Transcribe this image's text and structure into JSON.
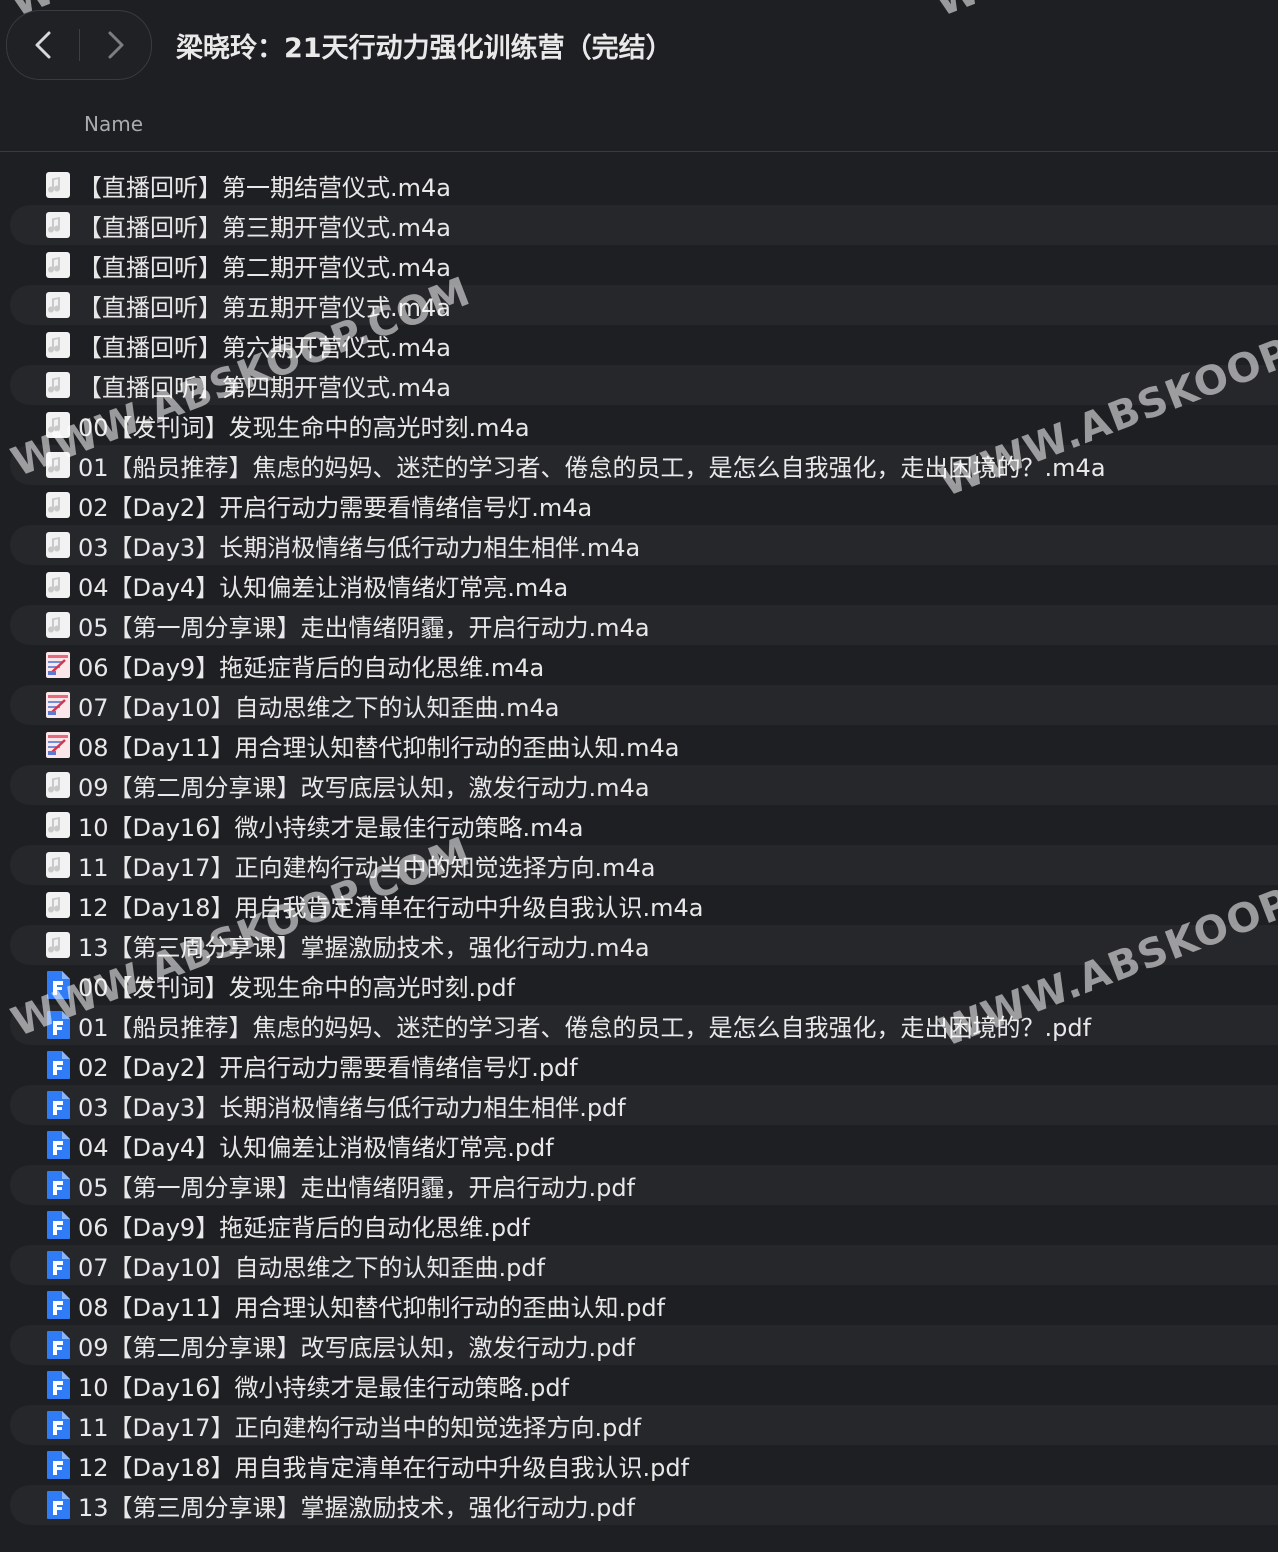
{
  "window": {
    "title": "梁晓玲：21天行动力强化训练营（完结）"
  },
  "toolbar": {
    "back_icon": "chevron-left-icon",
    "forward_icon": "chevron-right-icon"
  },
  "columns": {
    "name": "Name"
  },
  "files": [
    {
      "name": "【直播回听】第一期结营仪式.m4a",
      "icon": "audio"
    },
    {
      "name": "【直播回听】第三期开营仪式.m4a",
      "icon": "audio"
    },
    {
      "name": "【直播回听】第二期开营仪式.m4a",
      "icon": "audio"
    },
    {
      "name": "【直播回听】第五期开营仪式.m4a",
      "icon": "audio"
    },
    {
      "name": "【直播回听】第六期开营仪式.m4a",
      "icon": "audio"
    },
    {
      "name": "【直播回听】第四期开营仪式.m4a",
      "icon": "audio"
    },
    {
      "name": "00【发刊词】发现生命中的高光时刻.m4a",
      "icon": "audio"
    },
    {
      "name": "01【船员推荐】焦虑的妈妈、迷茫的学习者、倦怠的员工，是怎么自我强化，走出困境的？.m4a",
      "icon": "audio"
    },
    {
      "name": "02【Day2】开启行动力需要看情绪信号灯.m4a",
      "icon": "audio"
    },
    {
      "name": "03【Day3】长期消极情绪与低行动力相生相伴.m4a",
      "icon": "audio"
    },
    {
      "name": "04【Day4】认知偏差让消极情绪灯常亮.m4a",
      "icon": "audio"
    },
    {
      "name": "05【第一周分享课】走出情绪阴霾，开启行动力.m4a",
      "icon": "audio"
    },
    {
      "name": "06【Day9】拖延症背后的自动化思维.m4a",
      "icon": "thumb"
    },
    {
      "name": "07【Day10】自动思维之下的认知歪曲.m4a",
      "icon": "thumb"
    },
    {
      "name": "08【Day11】用合理认知替代抑制行动的歪曲认知.m4a",
      "icon": "thumb"
    },
    {
      "name": "09【第二周分享课】改写底层认知，激发行动力.m4a",
      "icon": "audio"
    },
    {
      "name": "10【Day16】微小持续才是最佳行动策略.m4a",
      "icon": "audio"
    },
    {
      "name": "11【Day17】正向建构行动当中的知觉选择方向.m4a",
      "icon": "audio"
    },
    {
      "name": "12【Day18】用自我肯定清单在行动中升级自我认识.m4a",
      "icon": "audio"
    },
    {
      "name": "13【第三周分享课】掌握激励技术，强化行动力.m4a",
      "icon": "audio"
    },
    {
      "name": "00【发刊词】发现生命中的高光时刻.pdf",
      "icon": "pdf"
    },
    {
      "name": "01【船员推荐】焦虑的妈妈、迷茫的学习者、倦怠的员工，是怎么自我强化，走出困境的？.pdf",
      "icon": "pdf"
    },
    {
      "name": "02【Day2】开启行动力需要看情绪信号灯.pdf",
      "icon": "pdf"
    },
    {
      "name": "03【Day3】长期消极情绪与低行动力相生相伴.pdf",
      "icon": "pdf"
    },
    {
      "name": "04【Day4】认知偏差让消极情绪灯常亮.pdf",
      "icon": "pdf"
    },
    {
      "name": "05【第一周分享课】走出情绪阴霾，开启行动力.pdf",
      "icon": "pdf"
    },
    {
      "name": "06【Day9】拖延症背后的自动化思维.pdf",
      "icon": "pdf"
    },
    {
      "name": "07【Day10】自动思维之下的认知歪曲.pdf",
      "icon": "pdf"
    },
    {
      "name": "08【Day11】用合理认知替代抑制行动的歪曲认知.pdf",
      "icon": "pdf"
    },
    {
      "name": "09【第二周分享课】改写底层认知，激发行动力.pdf",
      "icon": "pdf"
    },
    {
      "name": "10【Day16】微小持续才是最佳行动策略.pdf",
      "icon": "pdf"
    },
    {
      "name": "11【Day17】正向建构行动当中的知觉选择方向.pdf",
      "icon": "pdf"
    },
    {
      "name": "12【Day18】用自我肯定清单在行动中升级自我认识.pdf",
      "icon": "pdf"
    },
    {
      "name": "13【第三周分享课】掌握激励技术，强化行动力.pdf",
      "icon": "pdf"
    }
  ],
  "watermark": {
    "text": "WWW.ABSKOOP.COM"
  }
}
